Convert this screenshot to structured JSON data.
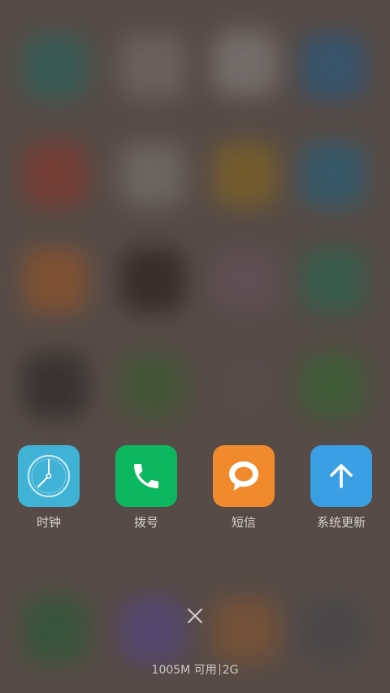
{
  "recent_apps": [
    {
      "label": "时钟",
      "icon": "clock-icon",
      "color": "#3fb2d6"
    },
    {
      "label": "拨号",
      "icon": "phone-icon",
      "color": "#0db760"
    },
    {
      "label": "短信",
      "icon": "message-icon",
      "color": "#f08a2c"
    },
    {
      "label": "系统更新",
      "icon": "arrow-up-icon",
      "color": "#3b9fe4"
    }
  ],
  "close_all": {
    "icon": "close-icon"
  },
  "memory": {
    "available_text": "1005M 可用",
    "total_text": "2G"
  }
}
